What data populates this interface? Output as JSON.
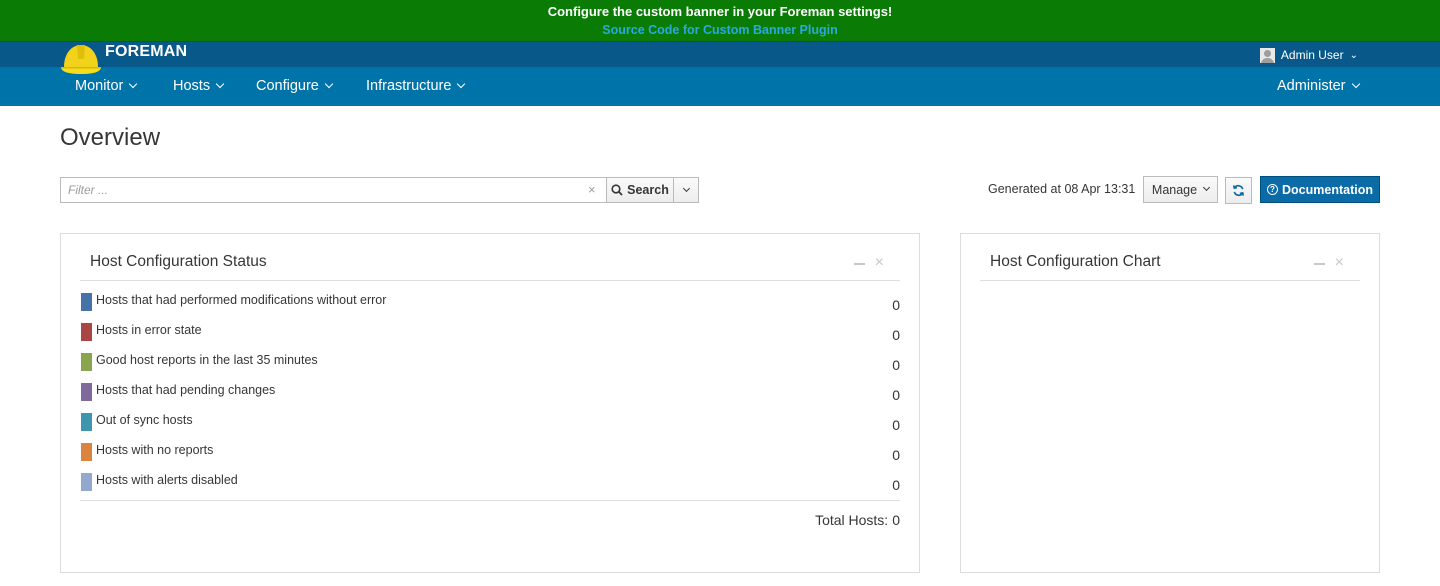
{
  "banner": {
    "message": "Configure the custom banner in your Foreman settings!",
    "link": "Source Code for Custom Banner Plugin",
    "background": "#0a7c05"
  },
  "brand": {
    "name": "FOREMAN",
    "icon": "hard-hat-icon"
  },
  "user": {
    "name": "Admin User",
    "icon": "user-avatar-icon"
  },
  "nav": {
    "items": [
      {
        "label": "Monitor"
      },
      {
        "label": "Hosts"
      },
      {
        "label": "Configure"
      },
      {
        "label": "Infrastructure"
      }
    ],
    "right": {
      "label": "Administer"
    },
    "background": "#0073a8"
  },
  "page": {
    "title": "Overview"
  },
  "search": {
    "placeholder": "Filter ...",
    "value": "",
    "button": "Search",
    "clear": "×"
  },
  "toolbar": {
    "generated": "Generated at 08 Apr 13:31",
    "manage": "Manage",
    "documentation": "Documentation"
  },
  "widgets": {
    "status": {
      "title": "Host Configuration Status",
      "rows": [
        {
          "label": "Hosts that had performed modifications without error",
          "count": "0",
          "color": "#4572a7"
        },
        {
          "label": "Hosts in error state",
          "count": "0",
          "color": "#aa4643"
        },
        {
          "label": "Good host reports in the last 35 minutes",
          "count": "0",
          "color": "#89a54e"
        },
        {
          "label": "Hosts that had pending changes",
          "count": "0",
          "color": "#80699b"
        },
        {
          "label": "Out of sync hosts",
          "count": "0",
          "color": "#3d96ae"
        },
        {
          "label": "Hosts with no reports",
          "count": "0",
          "color": "#db843d"
        },
        {
          "label": "Hosts with alerts disabled",
          "count": "0",
          "color": "#92a8cd"
        }
      ],
      "total_label": "Total Hosts:",
      "total_value": "0"
    },
    "chart": {
      "title": "Host Configuration Chart"
    }
  }
}
